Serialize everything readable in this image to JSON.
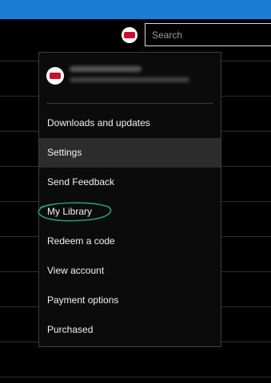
{
  "header": {
    "search_placeholder": "Search",
    "accent_color": "#1a7fd4",
    "avatar_icon": "account-avatar"
  },
  "account_menu": {
    "items": [
      {
        "label": "Downloads and updates"
      },
      {
        "label": "Settings",
        "selected": true
      },
      {
        "label": "Send Feedback"
      },
      {
        "label": "My Library",
        "annotated": true
      },
      {
        "label": "Redeem a code"
      },
      {
        "label": "View account"
      },
      {
        "label": "Payment options"
      },
      {
        "label": "Purchased"
      }
    ]
  },
  "annotation": {
    "color": "#1f9e6f",
    "shape": "hand-drawn-circle"
  }
}
